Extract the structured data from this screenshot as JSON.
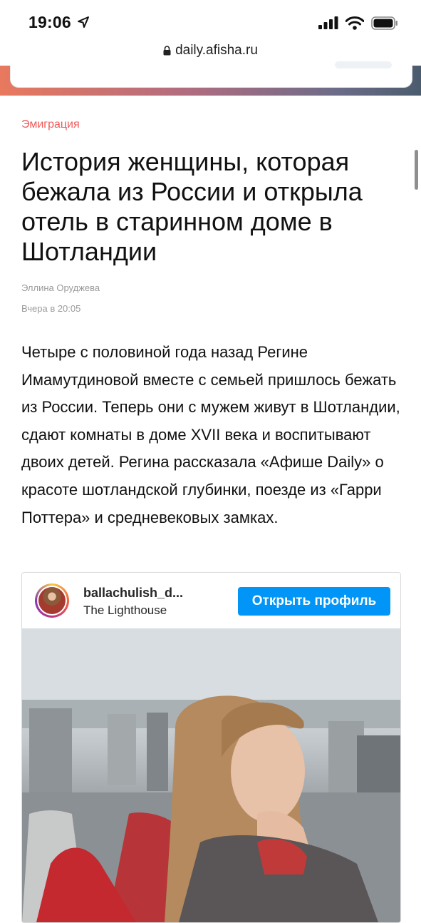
{
  "status_bar": {
    "time": "19:06"
  },
  "browser": {
    "url": "daily.afisha.ru"
  },
  "article": {
    "category": "Эмиграция",
    "title": "История женщины, которая бежала из России и открыла отель в старинном доме в Шотландии",
    "author": "Эллина Оруджева",
    "date": "Вчера в 20:05",
    "lead": "Четыре с половиной года назад Регине Имамутдиновой вместе с семьей пришлось бежать из России. Теперь они с мужем живут в Шотландии, сдают комнаты в доме XVII века и воспитывают двоих детей. Регина рассказала «Афише Daily» о красоте шотландской глубинки, поезде из «Гарри Поттера» и средневековых замках."
  },
  "instagram_embed": {
    "username": "ballachulish_d...",
    "location": "The Lighthouse",
    "open_profile_label": "Открыть профиль"
  },
  "colors": {
    "category": "#ef5b5b",
    "button": "#0095f6",
    "meta_text": "#9a9a9a"
  },
  "icons": [
    "location-arrow-icon",
    "cellular-signal-icon",
    "wifi-icon",
    "battery-icon",
    "lock-icon"
  ]
}
